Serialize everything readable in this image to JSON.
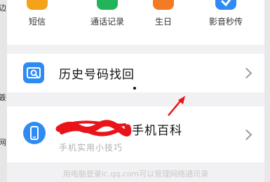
{
  "background": {
    "left_chars": [
      "边",
      "簽",
      "网"
    ]
  },
  "quick_actions": [
    {
      "label": "短信",
      "icon": "sms-icon",
      "color": "#f4a21a"
    },
    {
      "label": "通话记录",
      "icon": "call-log-icon",
      "color": "#22b45a"
    },
    {
      "label": "生日",
      "icon": "birthday-icon",
      "color": "#f27b23"
    },
    {
      "label": "影音秒传",
      "icon": "media-transfer-icon",
      "color": "#2f8bf4"
    }
  ],
  "rows": [
    {
      "title": "历史号码找回",
      "icon": "history-search-icon"
    },
    {
      "title": "手机百科",
      "subtitle": "手机实用小技巧",
      "icon": "phone-icon"
    }
  ],
  "footer_text": "用电脑登录ic.qq.com可以管理网络通讯录",
  "colors": {
    "accent": "#2f8bf4",
    "annotation_red": "#e8141a"
  }
}
